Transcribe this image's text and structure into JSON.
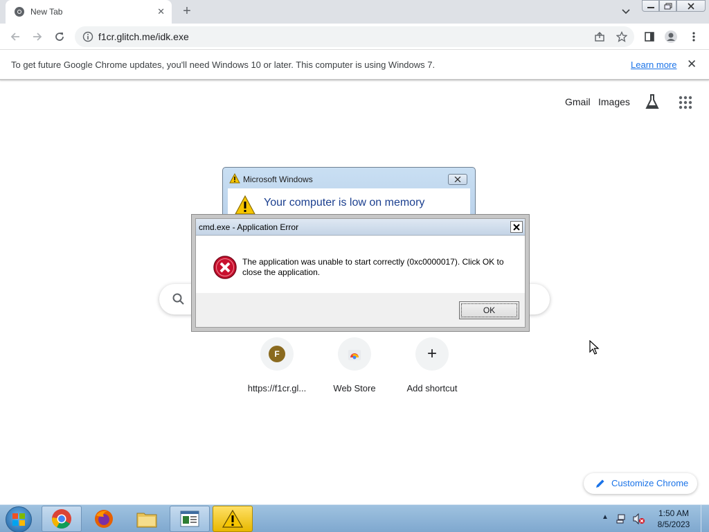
{
  "browser": {
    "tab": {
      "title": "New Tab",
      "close_icon": "close-icon"
    },
    "new_tab_symbol": "+",
    "address": "f1cr.glitch.me/idk.exe"
  },
  "infobar": {
    "message": "To get future Google Chrome updates, you'll need Windows 10 or later. This computer is using Windows 7.",
    "link": "Learn more",
    "close": "✕"
  },
  "ntp": {
    "top_links": [
      "Gmail",
      "Images"
    ],
    "shortcuts": [
      {
        "label": "https://f1cr.gl...",
        "icon_letter": "F"
      },
      {
        "label": "Web Store"
      },
      {
        "label": "Add shortcut",
        "icon": "+"
      }
    ],
    "customize_label": "Customize Chrome"
  },
  "memory_dialog": {
    "title": "Microsoft Windows",
    "message": "Your computer is low on memory"
  },
  "error_dialog": {
    "title": "cmd.exe - Application Error",
    "message": "The application was unable to start correctly (0xc0000017). Click OK to close the application.",
    "ok_label": "OK"
  },
  "taskbar": {
    "clock_time": "1:50 AM",
    "clock_date": "8/5/2023",
    "apps": [
      "chrome",
      "firefox",
      "explorer",
      "notepad",
      "warning"
    ]
  },
  "colors": {
    "chrome_blue": "#1a73e8",
    "error_red": "#c8102e",
    "taskbar": "#8fb5d8"
  }
}
